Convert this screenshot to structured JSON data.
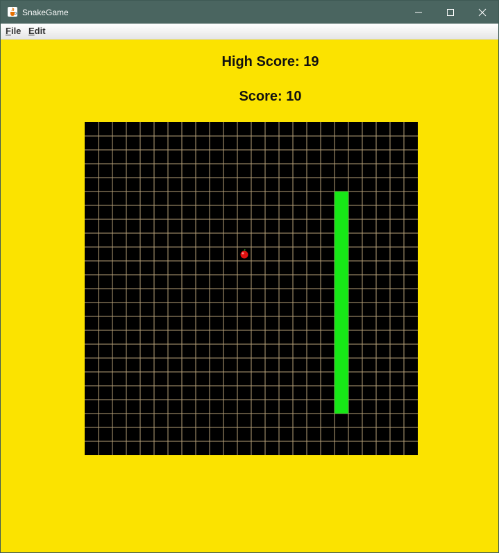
{
  "window": {
    "title": "SnakeGame",
    "icon": "java-coffee-cup-icon",
    "controls": [
      "minimize-icon",
      "maximize-icon",
      "close-icon"
    ]
  },
  "menu": {
    "items": [
      {
        "label": "File",
        "mnemonic": "F",
        "rest": "ile"
      },
      {
        "label": "Edit",
        "mnemonic": "E",
        "rest": "dit"
      }
    ]
  },
  "scoreboard": {
    "high_score_text": "High Score: 19",
    "score_text": "Score: 10"
  },
  "game": {
    "grid_cols": 24,
    "grid_rows": 24,
    "apple": {
      "col": 11,
      "row": 9
    },
    "snake": {
      "col": 18,
      "row_from": 5,
      "row_to": 20
    },
    "colors": {
      "background": "#fbe300",
      "board": "#000000",
      "grid_line": "#b8a27a",
      "snake": "#17e817",
      "apple": "#e01010"
    }
  }
}
